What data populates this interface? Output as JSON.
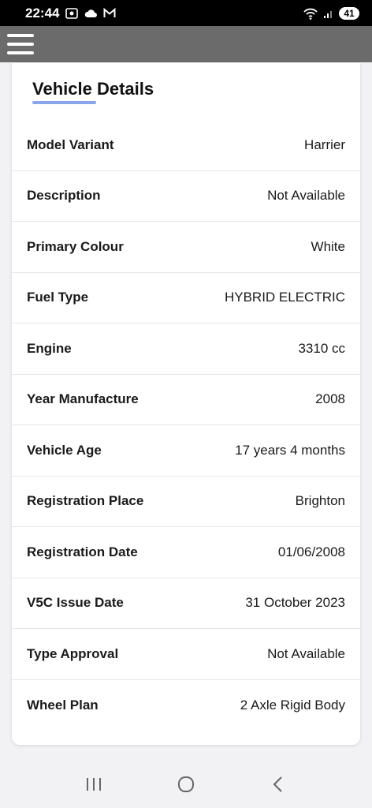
{
  "status_bar": {
    "time": "22:44",
    "battery": "41",
    "icons": [
      "screen-record-icon",
      "cloud-icon",
      "gmail-icon",
      "wifi-icon",
      "signal-icon",
      "battery-icon"
    ]
  },
  "app_bar": {
    "menu_icon": "hamburger-menu-icon",
    "color": "#6b6b6b"
  },
  "card": {
    "title": "Vehicle Details",
    "accent": "#8aa6ea",
    "rows": [
      {
        "label": "Model Variant",
        "value": "Harrier"
      },
      {
        "label": "Description",
        "value": "Not Available"
      },
      {
        "label": "Primary Colour",
        "value": "White"
      },
      {
        "label": "Fuel Type",
        "value": "HYBRID ELECTRIC"
      },
      {
        "label": "Engine",
        "value": "3310 cc"
      },
      {
        "label": "Year Manufacture",
        "value": "2008"
      },
      {
        "label": "Vehicle Age",
        "value": "17 years 4 months"
      },
      {
        "label": "Registration Place",
        "value": "Brighton"
      },
      {
        "label": "Registration Date",
        "value": "01/06/2008"
      },
      {
        "label": "V5C Issue Date",
        "value": "31 October 2023"
      },
      {
        "label": "Type Approval",
        "value": "Not Available"
      },
      {
        "label": "Wheel Plan",
        "value": "2 Axle Rigid Body"
      }
    ]
  },
  "nav_bar": {
    "buttons": [
      "recent-apps-icon",
      "home-icon",
      "back-icon"
    ]
  }
}
